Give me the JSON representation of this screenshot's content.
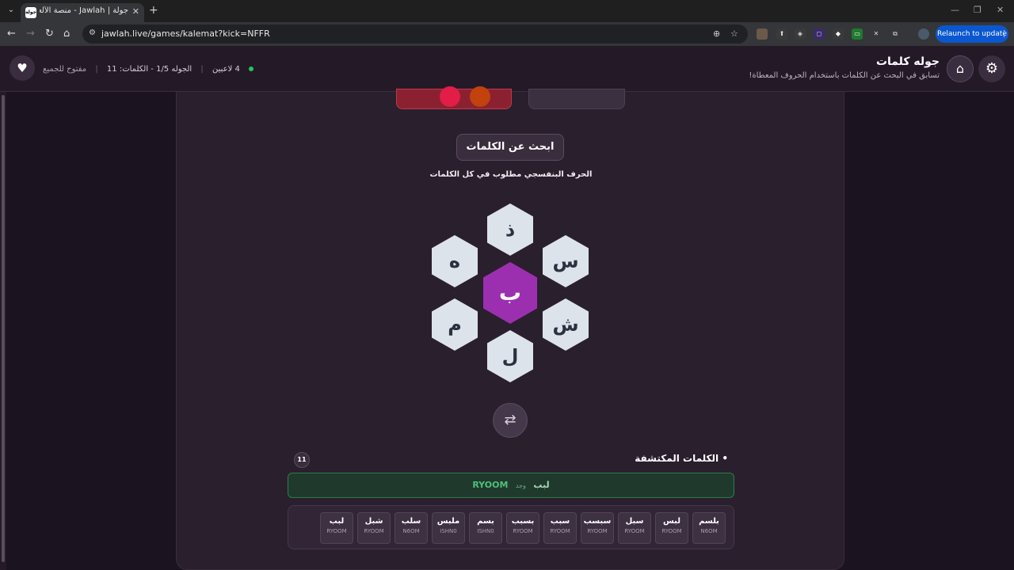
{
  "browser": {
    "tab_title": "جولة | Jawlah - منصة الألعاب الت...",
    "favicon_text": "جولة",
    "url_host": "jawlah.live",
    "url_path": "/games/kalemat?kick=NFFR",
    "relaunch_label": "Relaunch to update"
  },
  "header": {
    "title": "جوله كلمات",
    "subtitle": "تسابق في البحث عن الكلمات باستخدام الحروف المعطاة!",
    "players": "4 لاعبين",
    "round": "الجوله 1/5 - الكلمات: 11",
    "access": "مفتوح للجميع"
  },
  "game": {
    "search_title": "ابحث عن الكلمات",
    "hint": "الحرف البنفسجي مطلوب في كل الكلمات",
    "center_letter": "ب",
    "letters": {
      "top": "ذ",
      "top_right": "س",
      "bottom_right": "ش",
      "bottom": "ل",
      "bottom_left": "م",
      "top_left": "ه"
    },
    "colors": {
      "center": "#9c2fb0",
      "outer": "#dde3ea"
    }
  },
  "found": {
    "title": "الكلمات المكتشفة",
    "count": "11",
    "last": {
      "word": "لبب",
      "verb": "وجد",
      "player": "RYOOM"
    },
    "words": [
      {
        "word": "بلسم",
        "player": "N6OM"
      },
      {
        "word": "لبس",
        "player": "RYOOM"
      },
      {
        "word": "سبل",
        "player": "RYOOM"
      },
      {
        "word": "سبسب",
        "player": "RYOOM"
      },
      {
        "word": "سبب",
        "player": "RYOOM"
      },
      {
        "word": "بسبب",
        "player": "RYOOM"
      },
      {
        "word": "بسم",
        "player": "ISHN0"
      },
      {
        "word": "ملبس",
        "player": "ISHN0"
      },
      {
        "word": "سلب",
        "player": "N6OM"
      },
      {
        "word": "شبل",
        "player": "RYOOM"
      },
      {
        "word": "لبب",
        "player": "RYOOM"
      }
    ]
  }
}
